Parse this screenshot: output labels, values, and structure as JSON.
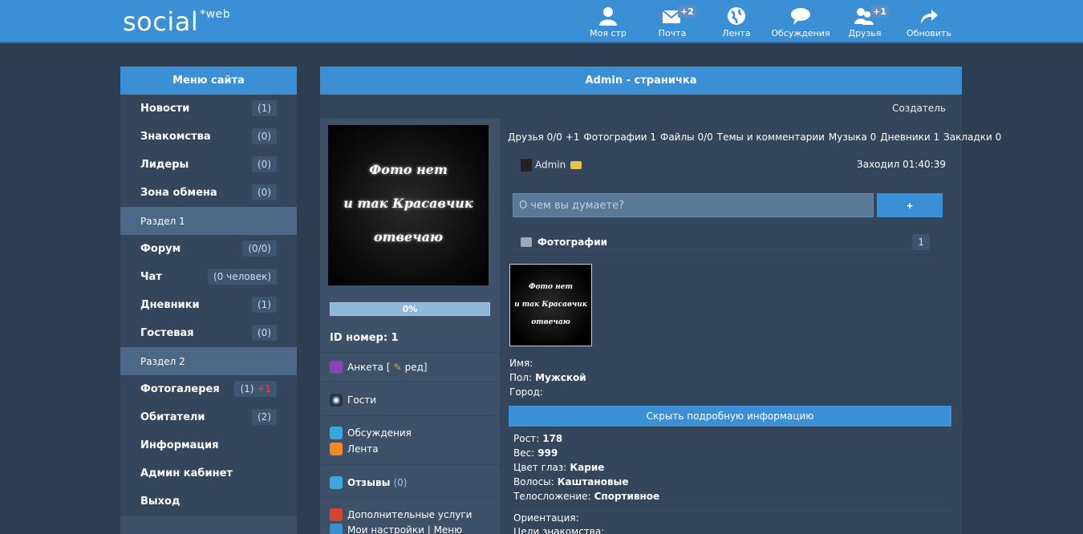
{
  "header": {
    "logo": "social",
    "logo_sup": "*web",
    "nav": [
      {
        "label": "Моя стр",
        "icon": "user-icon",
        "badge": ""
      },
      {
        "label": "Почта",
        "icon": "mail-icon",
        "badge": "+2"
      },
      {
        "label": "Лента",
        "icon": "globe-icon",
        "badge": ""
      },
      {
        "label": "Обсуждения",
        "icon": "chat-bubble-icon",
        "badge": ""
      },
      {
        "label": "Друзья",
        "icon": "friends-icon",
        "badge": "+1"
      },
      {
        "label": "Обновить",
        "icon": "refresh-arrow-icon",
        "badge": ""
      }
    ]
  },
  "sidebar": {
    "title": "Меню сайта",
    "items": [
      {
        "label": "Новости",
        "count": "(1)"
      },
      {
        "label": "Знакомства",
        "count": "(0)"
      },
      {
        "label": "Лидеры",
        "count": "(0)"
      },
      {
        "label": "Зона обмена",
        "count": "(0)"
      }
    ],
    "section1": "Раздел 1",
    "items2": [
      {
        "label": "Форум",
        "count": "(0/0)"
      },
      {
        "label": "Чат",
        "count": "(0 человек)"
      },
      {
        "label": "Дневники",
        "count": "(1)"
      },
      {
        "label": "Гостевая",
        "count": "(0)"
      }
    ],
    "section2": "Раздел 2",
    "items3": [
      {
        "label": "Фотогалерея",
        "count": "(1)",
        "extra": "+1"
      },
      {
        "label": "Обитатели",
        "count": "(2)"
      },
      {
        "label": "Информация",
        "count": ""
      },
      {
        "label": "Админ кабинет",
        "count": ""
      },
      {
        "label": "Выход",
        "count": ""
      }
    ]
  },
  "main": {
    "title": "Admin - страничка",
    "creator": "Создатель",
    "avatar_lines": [
      "Фото нет",
      "и так Красавчик",
      "отвечаю"
    ],
    "progress_text": "0%",
    "progress_value": 0,
    "id_label": "ID номер: 1",
    "links": {
      "anketa": "Анкета [",
      "anketa_edit": "ред]",
      "guests": "Гости",
      "discussions": "Обсуждения",
      "feed": "Лента",
      "reviews": "Отзывы",
      "reviews_count": "(0)",
      "services": "Дополнительные услуги",
      "settings": "Мои настройки | Меню"
    },
    "counts": [
      "Друзья 0/0 +1",
      "Фотографии 1",
      "Файлы 0/0",
      "Темы и комментарии",
      "Музыка 0",
      "Дневники 1",
      "Закладки 0"
    ],
    "username": "Admin",
    "last_seen": "Заходил 01:40:39",
    "status_placeholder": "О чем вы думаете?",
    "plus_label": "+",
    "photos_label": "Фотографии",
    "photos_count": "1",
    "info": {
      "name_label": "Имя:",
      "name_value": "",
      "sex_label": "Пол:",
      "sex_value": "Мужской",
      "city_label": "Город:",
      "city_value": ""
    },
    "detail_button": "Скрыть подробную информацию",
    "details": {
      "height_label": "Рост:",
      "height_value": "178",
      "weight_label": "Вес:",
      "weight_value": "999",
      "eyes_label": "Цвет глаз:",
      "eyes_value": "Карие",
      "hair_label": "Волосы:",
      "hair_value": "Каштановые",
      "body_label": "Телосложение:",
      "body_value": "Спортивное",
      "orientation_label": "Ориентация:",
      "goals_label": "Цели знакомства:"
    }
  },
  "colors": {
    "header": "#3b8fd5",
    "background": "#2d3d52",
    "sidebar": "#33465c",
    "accent_red": "#e34848"
  }
}
